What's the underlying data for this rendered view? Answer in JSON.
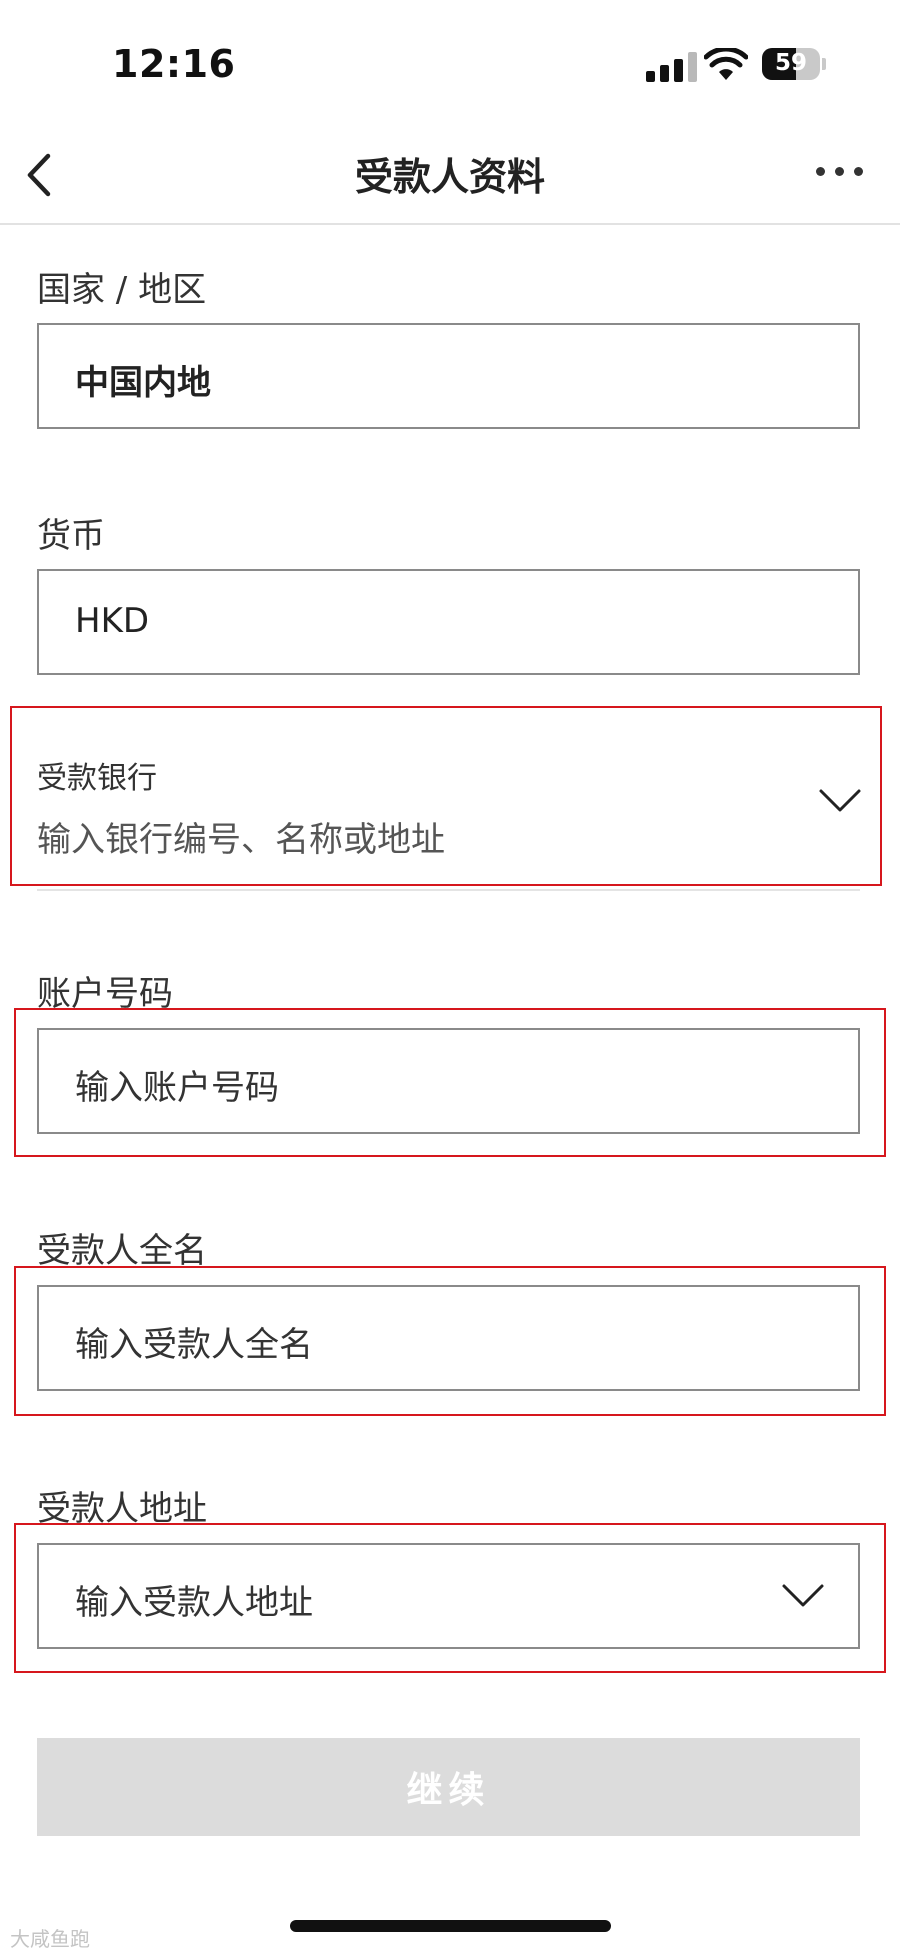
{
  "status_bar": {
    "time": "12:16",
    "battery": "59",
    "icons": [
      "cellular-signal-icon",
      "wifi-icon",
      "battery-icon"
    ]
  },
  "header": {
    "title": "受款人资料",
    "icons": [
      "back-chevron-icon",
      "more-dots-icon"
    ]
  },
  "form": {
    "country": {
      "label": "国家 / 地区",
      "value": "中国内地"
    },
    "currency": {
      "label": "货币",
      "value": "HKD"
    },
    "bank": {
      "label": "受款银行",
      "placeholder": "输入银行编号、名称或地址"
    },
    "account": {
      "label": "账户号码",
      "placeholder": "输入账户号码"
    },
    "payee_name": {
      "label": "受款人全名",
      "placeholder": "输入受款人全名"
    },
    "payee_address": {
      "label": "受款人地址",
      "placeholder": "输入受款人地址"
    }
  },
  "continue_label": "继续",
  "watermark": "大咸鱼跑",
  "colors": {
    "highlight": "#d6171d",
    "button_disabled": "#dcdcdc",
    "border": "#8a8a8a"
  }
}
